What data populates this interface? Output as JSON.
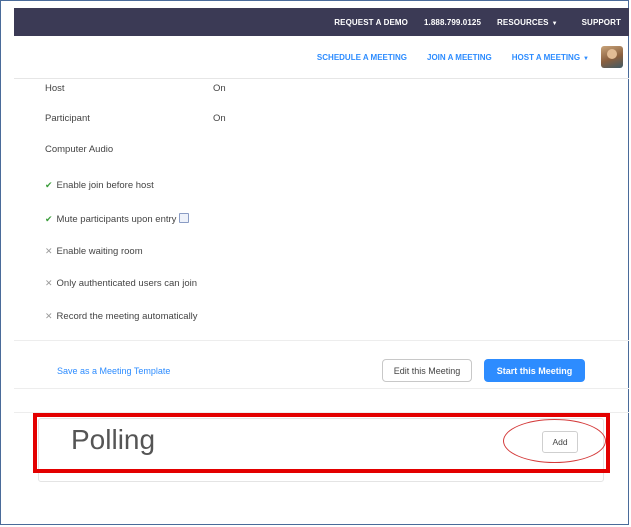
{
  "topbar": {
    "request_demo": "REQUEST A DEMO",
    "phone": "1.888.799.0125",
    "resources": "RESOURCES",
    "support": "SUPPORT"
  },
  "nav": {
    "schedule": "SCHEDULE A MEETING",
    "join": "JOIN A MEETING",
    "host": "HOST A MEETING"
  },
  "settings": {
    "host_label": "Host",
    "host_value": "On",
    "participant_label": "Participant",
    "participant_value": "On",
    "computer_audio": "Computer Audio",
    "options": [
      {
        "label": "Enable join before host",
        "checked": true
      },
      {
        "label": "Mute participants upon entry",
        "checked": true
      },
      {
        "label": "Enable waiting room",
        "checked": false
      },
      {
        "label": "Only authenticated users can join",
        "checked": false
      },
      {
        "label": "Record the meeting automatically",
        "checked": false
      }
    ]
  },
  "actions": {
    "save_template": "Save as a Meeting Template",
    "edit": "Edit this Meeting",
    "start": "Start this Meeting"
  },
  "polling": {
    "title": "Polling",
    "add": "Add"
  },
  "colors": {
    "accent": "#2d8cff",
    "topbar": "#3b3a55",
    "highlight": "#e30000"
  }
}
